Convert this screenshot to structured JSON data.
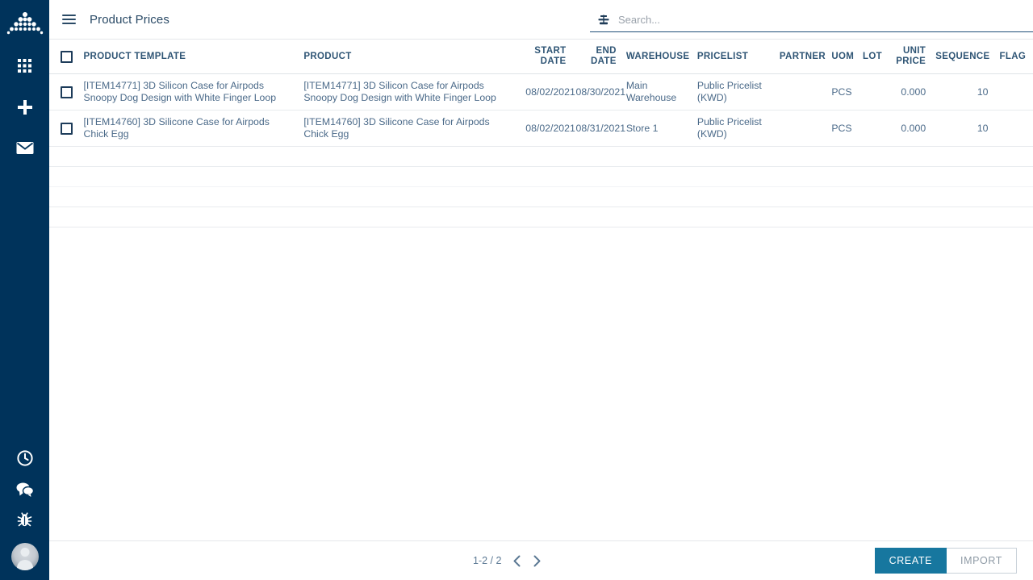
{
  "sidebar": {
    "logo": {
      "name": "pyramid-dots-logo"
    },
    "top_items": [
      {
        "name": "apps-grid-icon",
        "label": "Apps"
      },
      {
        "name": "plus-icon",
        "label": "New"
      },
      {
        "name": "envelope-icon",
        "label": "Messages"
      }
    ],
    "bottom_items": [
      {
        "name": "clock-icon",
        "label": "Activity"
      },
      {
        "name": "chat-icon",
        "label": "Chat"
      },
      {
        "name": "bug-icon",
        "label": "Debug"
      }
    ],
    "avatar": {
      "name": "user-avatar",
      "label": "User"
    },
    "background_color": "#00335b"
  },
  "topbar": {
    "menu_label": "Menu",
    "title": "Product Prices"
  },
  "search": {
    "icon": "filter-sort-icon",
    "placeholder": "Search...",
    "value": ""
  },
  "table": {
    "select_all_label": "Select all",
    "columns": [
      {
        "key": "product_template",
        "label": "PRODUCT TEMPLATE"
      },
      {
        "key": "product",
        "label": "PRODUCT"
      },
      {
        "key": "start_date",
        "label": "START DATE"
      },
      {
        "key": "end_date",
        "label": "END DATE"
      },
      {
        "key": "warehouse",
        "label": "WAREHOUSE"
      },
      {
        "key": "pricelist",
        "label": "PRICELIST"
      },
      {
        "key": "partner",
        "label": "PARTNER"
      },
      {
        "key": "uom",
        "label": "UOM"
      },
      {
        "key": "lot",
        "label": "LOT"
      },
      {
        "key": "unit_price",
        "label": "UNIT PRICE"
      },
      {
        "key": "sequence",
        "label": "SEQUENCE"
      },
      {
        "key": "flag",
        "label": "FLAG"
      }
    ],
    "rows": [
      {
        "product_template": "[ITEM14771] 3D Silicon Case for Airpods Snoopy Dog Design with White Finger Loop",
        "product": "[ITEM14771] 3D Silicon Case for Airpods Snoopy Dog Design with White Finger Loop",
        "start_date": "08/02/2021",
        "end_date": "08/30/2021",
        "warehouse": "Main Warehouse",
        "pricelist": "Public Pricelist (KWD)",
        "partner": "",
        "uom": "PCS",
        "lot": "",
        "unit_price": "0.000",
        "sequence": "10",
        "flag": ""
      },
      {
        "product_template": "[ITEM14760] 3D Silicone Case for Airpods Chick Egg",
        "product": "[ITEM14760] 3D Silicone Case for Airpods Chick Egg",
        "start_date": "08/02/2021",
        "end_date": "08/31/2021",
        "warehouse": "Store 1",
        "pricelist": "Public Pricelist (KWD)",
        "partner": "",
        "uom": "PCS",
        "lot": "",
        "unit_price": "0.000",
        "sequence": "10",
        "flag": ""
      }
    ]
  },
  "footer": {
    "pager_range": "1-2 / 2",
    "prev_label": "Previous",
    "next_label": "Next",
    "create_label": "CREATE",
    "import_label": "IMPORT",
    "create_color": "#17779f"
  }
}
